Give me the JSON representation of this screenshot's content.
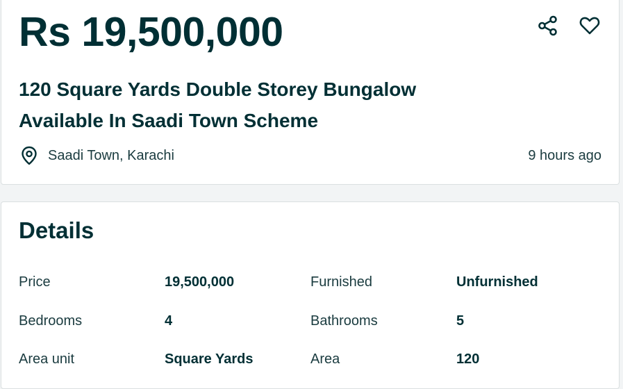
{
  "listing": {
    "price": "Rs 19,500,000",
    "title_line1": "120 Square Yards Double Storey Bungalow",
    "title_line2": "Available In Saadi Town Scheme",
    "location": "Saadi Town, Karachi",
    "posted": "9 hours ago",
    "share_icon": "share-icon",
    "favorite_icon": "heart-icon",
    "location_icon": "location-pin-icon"
  },
  "details": {
    "heading": "Details",
    "rows": [
      {
        "label1": "Price",
        "value1": "19,500,000",
        "label2": "Furnished",
        "value2": "Unfurnished"
      },
      {
        "label1": "Bedrooms",
        "value1": "4",
        "label2": "Bathrooms",
        "value2": "5"
      },
      {
        "label1": "Area unit",
        "value1": "Square Yards",
        "label2": "Area",
        "value2": "120"
      }
    ]
  },
  "colors": {
    "text_primary": "#002f34",
    "background": "#f2f4f5",
    "card": "#ffffff",
    "border": "#dadfe0"
  }
}
